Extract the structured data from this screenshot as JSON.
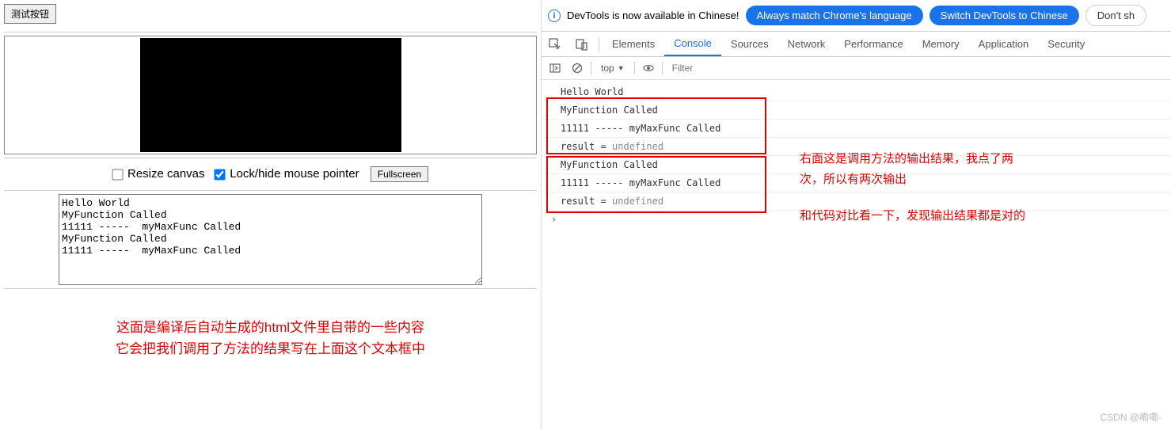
{
  "left": {
    "test_button": "测试按钮",
    "resize_label": "Resize canvas",
    "lock_label": "Lock/hide mouse pointer",
    "fullscreen_label": "Fullscreen",
    "output_text": "Hello World\nMyFunction Called\n11111 -----  myMaxFunc Called\nMyFunction Called\n11111 -----  myMaxFunc Called",
    "annotation_line1": "这面是编译后自动生成的html文件里自带的一些内容",
    "annotation_line2": "它会把我们调用了方法的结果写在上面这个文本框中"
  },
  "devtools": {
    "notice_text": "DevTools is now available in Chinese!",
    "pill_always": "Always match Chrome's language",
    "pill_switch": "Switch DevTools to Chinese",
    "pill_dont": "Don't sh",
    "tabs": {
      "elements": "Elements",
      "console": "Console",
      "sources": "Sources",
      "network": "Network",
      "performance": "Performance",
      "memory": "Memory",
      "application": "Application",
      "security": "Security"
    },
    "context": "top",
    "filter_placeholder": "Filter",
    "log_lines": [
      {
        "text": "Hello World"
      },
      {
        "text": "MyFunction Called"
      },
      {
        "text": "11111 -----  myMaxFunc Called"
      },
      {
        "prefix": "result = ",
        "value": "undefined"
      },
      {
        "text": "MyFunction Called"
      },
      {
        "text": "11111 -----  myMaxFunc Called"
      },
      {
        "prefix": "result = ",
        "value": "undefined"
      }
    ],
    "prompt": "›"
  },
  "right_annotation": {
    "line1": "右面这是调用方法的输出结果，我点了两",
    "line2": "次，所以有两次输出",
    "line3": "和代码对比看一下，发现输出结果都是对的"
  },
  "watermark": "CSDN @嘞嘞-"
}
